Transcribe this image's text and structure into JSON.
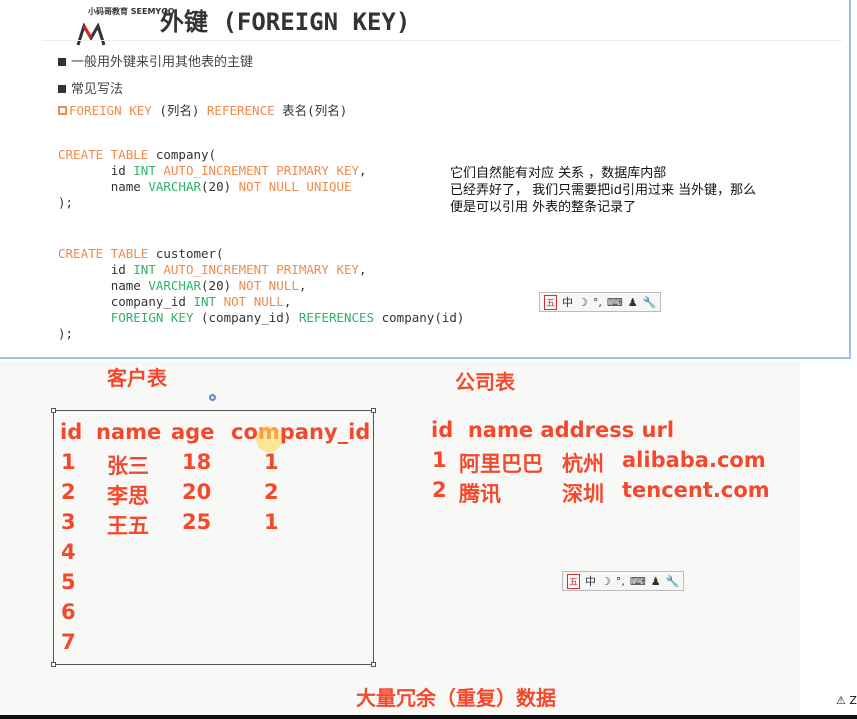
{
  "slide": {
    "logo_text": "小码哥教育 SEEMYGO",
    "title": "外键 (FOREIGN KEY)",
    "bullets": [
      "一般用外键来引用其他表的主键",
      "常见写法"
    ],
    "syntax": {
      "kw1": "FOREIGN KEY",
      "col": " (列名) ",
      "kw2": "REFERENCE",
      "rest": " 表名(列名)"
    },
    "code1": [
      "CREATE TABLE",
      " company(",
      "id ",
      "INT ",
      "AUTO_INCREMENT PRIMARY KEY",
      ",",
      "name ",
      "VARCHAR",
      "(20) ",
      "NOT NULL UNIQUE",
      ");"
    ],
    "code2": [
      "CREATE TABLE",
      " customer(",
      "id ",
      "INT ",
      "AUTO_INCREMENT PRIMARY KEY",
      ",",
      "name ",
      "VARCHAR",
      "(20) ",
      "NOT NULL",
      ",",
      "company_id ",
      "INT ",
      "NOT NULL",
      ",",
      "FOREIGN KEY",
      " (company_id) ",
      "REFERENCES",
      " company(id)",
      ");"
    ]
  },
  "note": [
    "它们自然能有对应 关系 ，数据库内部",
    "已经弄好了， 我们只需要把id引用过来 当外键，那么",
    "便是可以引用 外表的整条记录了"
  ],
  "ime": {
    "items": [
      "五",
      "中",
      "☽",
      "°,",
      "⌨",
      "♟",
      "🔧"
    ]
  },
  "customer": {
    "title": "客户表",
    "headers": [
      "id",
      "name",
      "age",
      "company_id"
    ],
    "rows": [
      [
        "1",
        "张三",
        "18",
        "1"
      ],
      [
        "2",
        "李思",
        "20",
        "2"
      ],
      [
        "3",
        "王五",
        "25",
        "1"
      ],
      [
        "4"
      ],
      [
        "5"
      ],
      [
        "6"
      ],
      [
        "7"
      ]
    ]
  },
  "company": {
    "title": "公司表",
    "header": "id  name address url",
    "rows": [
      [
        "1",
        "阿里巴巴",
        "杭州",
        "alibaba.com"
      ],
      [
        "2",
        "腾讯",
        "深圳",
        "tencent.com"
      ]
    ]
  },
  "footer_text": "大量冗余（重复）数据",
  "status": "⚠ Z",
  "colors": {
    "red": "#f4482c",
    "orange": "#f08a4b",
    "green": "#2fb36a"
  }
}
